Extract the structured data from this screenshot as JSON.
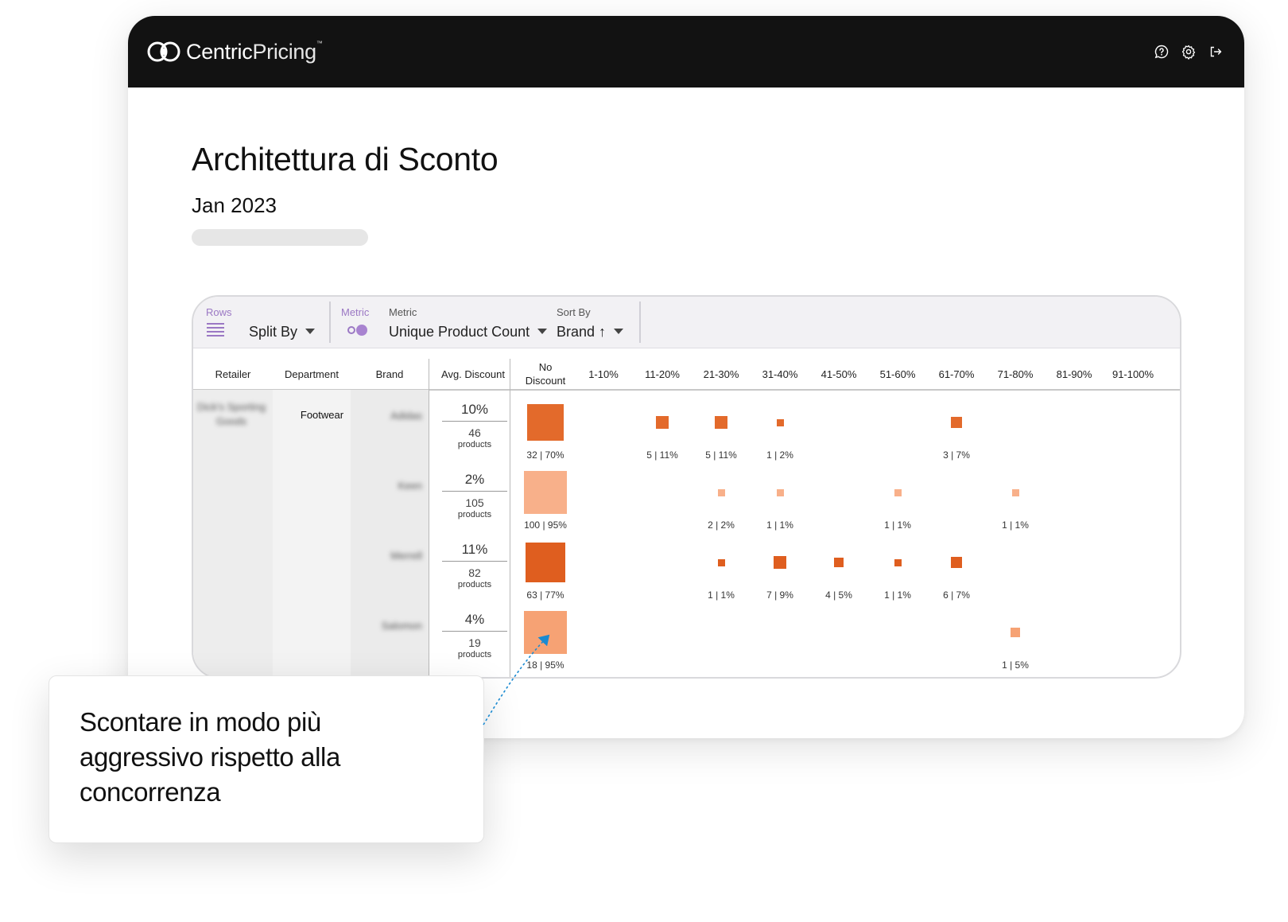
{
  "app": {
    "logo_text_bold": "Centric",
    "logo_text_light": "Pricing",
    "logo_tm": "™",
    "top_icons": [
      "help-icon",
      "gear-icon",
      "logout-icon"
    ]
  },
  "page": {
    "title": "Architettura di Sconto",
    "subtitle": "Jan 2023"
  },
  "toolbar": {
    "rows_label": "Rows",
    "split_by": "Split By",
    "metric_toggle_label": "Metric",
    "metric_label": "Metric",
    "metric_value": "Unique Product Count",
    "sort_label": "Sort By",
    "sort_value": "Brand ↑"
  },
  "columns": {
    "retailer": "Retailer",
    "department": "Department",
    "brand": "Brand",
    "avg_discount": "Avg. Discount",
    "buckets": [
      "No Discount",
      "1-10%",
      "11-20%",
      "21-30%",
      "31-40%",
      "41-50%",
      "51-60%",
      "61-70%",
      "71-80%",
      "81-90%",
      "91-100%"
    ]
  },
  "table": {
    "retailer": "Dick's Sporting Goods",
    "department": "Footwear",
    "rows": [
      {
        "brand": "Adidas",
        "avg": "10%",
        "count": "46",
        "unit": "products",
        "cells": [
          {
            "col": 0,
            "label": "32 | 70%",
            "share": 0.7,
            "color": "#e36a2b"
          },
          {
            "col": 2,
            "label": "5 | 11%",
            "share": 0.11,
            "color": "#e36a2b"
          },
          {
            "col": 3,
            "label": "5 | 11%",
            "share": 0.11,
            "color": "#e36a2b"
          },
          {
            "col": 4,
            "label": "1 | 2%",
            "share": 0.02,
            "color": "#e36a2b"
          },
          {
            "col": 7,
            "label": "3 | 7%",
            "share": 0.07,
            "color": "#e36a2b"
          }
        ]
      },
      {
        "brand": "Keen",
        "avg": "2%",
        "count": "105",
        "unit": "products",
        "cells": [
          {
            "col": 0,
            "label": "100 | 95%",
            "share": 0.95,
            "color": "#f8b08a"
          },
          {
            "col": 3,
            "label": "2 | 2%",
            "share": 0.02,
            "color": "#f8b08a"
          },
          {
            "col": 4,
            "label": "1 | 1%",
            "share": 0.01,
            "color": "#f8b08a"
          },
          {
            "col": 6,
            "label": "1 | 1%",
            "share": 0.01,
            "color": "#f8b08a"
          },
          {
            "col": 8,
            "label": "1 | 1%",
            "share": 0.01,
            "color": "#f8b08a"
          }
        ]
      },
      {
        "brand": "Merrell",
        "avg": "11%",
        "count": "82",
        "unit": "products",
        "cells": [
          {
            "col": 0,
            "label": "63 | 77%",
            "share": 0.77,
            "color": "#df5e1f"
          },
          {
            "col": 3,
            "label": "1 | 1%",
            "share": 0.01,
            "color": "#df5e1f"
          },
          {
            "col": 4,
            "label": "7 | 9%",
            "share": 0.09,
            "color": "#df5e1f"
          },
          {
            "col": 5,
            "label": "4 | 5%",
            "share": 0.05,
            "color": "#df5e1f"
          },
          {
            "col": 6,
            "label": "1 | 1%",
            "share": 0.01,
            "color": "#df5e1f"
          },
          {
            "col": 7,
            "label": "6 | 7%",
            "share": 0.07,
            "color": "#df5e1f"
          }
        ]
      },
      {
        "brand": "Salomon",
        "avg": "4%",
        "count": "19",
        "unit": "products",
        "cells": [
          {
            "col": 0,
            "label": "18 | 95%",
            "share": 0.95,
            "color": "#f6a274"
          },
          {
            "col": 8,
            "label": "1 | 5%",
            "share": 0.05,
            "color": "#f6a274"
          }
        ]
      }
    ]
  },
  "callout": {
    "text": "Scontare in modo più aggressivo rispetto alla concorrenza"
  }
}
